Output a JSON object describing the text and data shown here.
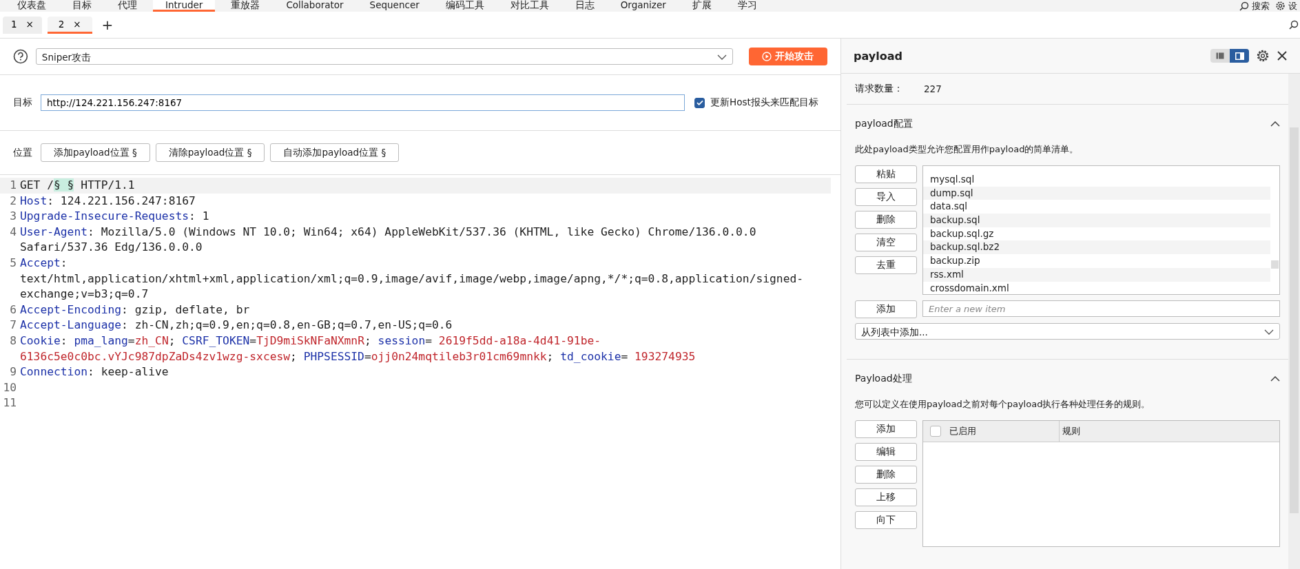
{
  "menu_tabs": [
    {
      "label": "仪表盘",
      "selected": false
    },
    {
      "label": "目标",
      "selected": false
    },
    {
      "label": "代理",
      "selected": false
    },
    {
      "label": "Intruder",
      "selected": true
    },
    {
      "label": "重放器",
      "selected": false
    },
    {
      "label": "Collaborator",
      "selected": false
    },
    {
      "label": "Sequencer",
      "selected": false
    },
    {
      "label": "编码工具",
      "selected": false
    },
    {
      "label": "对比工具",
      "selected": false
    },
    {
      "label": "日志",
      "selected": false
    },
    {
      "label": "Organizer",
      "selected": false
    },
    {
      "label": "扩展",
      "selected": false
    },
    {
      "label": "学习",
      "selected": false
    }
  ],
  "top_right": {
    "search_label": "搜索",
    "settings_label": "设"
  },
  "request_tabs": [
    {
      "label": "1",
      "close": "×",
      "selected": false
    },
    {
      "label": "2",
      "close": "×",
      "selected": true
    }
  ],
  "add_tab": "+",
  "attack": {
    "type": "Sniper攻击",
    "start_button": "开始攻击"
  },
  "target": {
    "label": "目标",
    "value": "http://124.221.156.247:8167",
    "update_host": {
      "label": "更新Host报头来匹配目标",
      "checked": true
    }
  },
  "positions": {
    "label": "位置",
    "buttons": [
      "添加payload位置 §",
      "清除payload位置 §",
      "自动添加payload位置 §"
    ]
  },
  "request_lines": [
    {
      "number": "1",
      "segments": [
        {
          "text": "GET /",
          "kind": "plain"
        },
        {
          "text": "§ §",
          "kind": "marker"
        },
        {
          "text": " HTTP/1.1",
          "kind": "plain"
        }
      ]
    },
    {
      "number": "2",
      "segments": [
        {
          "text": "Host",
          "kind": "name"
        },
        {
          "text": ": 124.221.156.247:8167",
          "kind": "plain"
        }
      ]
    },
    {
      "number": "3",
      "segments": [
        {
          "text": "Upgrade-Insecure-Requests",
          "kind": "name"
        },
        {
          "text": ": 1",
          "kind": "plain"
        }
      ]
    },
    {
      "number": "4",
      "segments": [
        {
          "text": "User-Agent",
          "kind": "name"
        },
        {
          "text": ": Mozilla/5.0 (Windows NT 10.0; Win64; x64) AppleWebKit/537.36 (KHTML, like Gecko) Chrome/136.0.0.0 Safari/537.36 Edg/136.0.0.0",
          "kind": "plain"
        }
      ]
    },
    {
      "number": "5",
      "segments": [
        {
          "text": "Accept",
          "kind": "name"
        },
        {
          "text": ": text/html,application/xhtml+xml,application/xml;q=0.9,image/avif,image/webp,image/apng,*/*;q=0.8,application/signed-exchange;v=b3;q=0.7",
          "kind": "plain"
        }
      ]
    },
    {
      "number": "6",
      "segments": [
        {
          "text": "Accept-Encoding",
          "kind": "name"
        },
        {
          "text": ": gzip, deflate, br",
          "kind": "plain"
        }
      ]
    },
    {
      "number": "7",
      "segments": [
        {
          "text": "Accept-Language",
          "kind": "name"
        },
        {
          "text": ": zh-CN,zh;q=0.9,en;q=0.8,en-GB;q=0.7,en-US;q=0.6",
          "kind": "plain"
        }
      ]
    },
    {
      "number": "8",
      "segments": [
        {
          "text": "Cookie",
          "kind": "name"
        },
        {
          "text": ": ",
          "kind": "plain"
        },
        {
          "text": "pma_lang",
          "kind": "name"
        },
        {
          "text": "=",
          "kind": "plain"
        },
        {
          "text": "zh_CN",
          "kind": "value"
        },
        {
          "text": "; ",
          "kind": "plain"
        },
        {
          "text": "CSRF_TOKEN",
          "kind": "name"
        },
        {
          "text": "=",
          "kind": "plain"
        },
        {
          "text": "TjD9miSkNFaNXmnR",
          "kind": "value"
        },
        {
          "text": "; ",
          "kind": "plain"
        },
        {
          "text": "session",
          "kind": "name"
        },
        {
          "text": "= ",
          "kind": "plain"
        },
        {
          "text": "2619f5dd-a18a-4d41-91be-6136c5e0c0bc.vYJc987dpZaDs4zv1wzg-sxcesw",
          "kind": "value"
        },
        {
          "text": "; ",
          "kind": "plain"
        },
        {
          "text": "PHPSESSID",
          "kind": "name"
        },
        {
          "text": "=",
          "kind": "plain"
        },
        {
          "text": "ojj0n24mqtileb3r01cm69mnkk",
          "kind": "value"
        },
        {
          "text": "; ",
          "kind": "plain"
        },
        {
          "text": "td_cookie",
          "kind": "name"
        },
        {
          "text": "= ",
          "kind": "plain"
        },
        {
          "text": "193274935",
          "kind": "value"
        }
      ]
    },
    {
      "number": "9",
      "segments": [
        {
          "text": "Connection",
          "kind": "name"
        },
        {
          "text": ": keep-alive",
          "kind": "plain"
        }
      ]
    },
    {
      "number": "10"
    },
    {
      "number": "11"
    }
  ],
  "payload_panel": {
    "title": "payload",
    "view_modes": [
      {
        "selected": false
      },
      {
        "selected": true
      }
    ],
    "request_count": {
      "label": "请求数量：",
      "value": "227"
    },
    "config": {
      "title": "payload配置",
      "expanded": true,
      "description": "此处payload类型允许您配置用作payload的简单清单。",
      "buttons": [
        "粘贴",
        "导入",
        "删除",
        "清空",
        "去重"
      ],
      "items": [
        "mysql.sql",
        "dump.sql",
        "data.sql",
        "backup.sql",
        "backup.sql.gz",
        "backup.sql.bz2",
        "backup.zip",
        "rss.xml",
        "crossdomain.xml"
      ],
      "add_button": "添加",
      "new_item_placeholder": "Enter a new item",
      "add_from_list": "从列表中添加..."
    },
    "processing": {
      "title": "Payload处理",
      "expanded": true,
      "description": "您可以定义在使用payload之前对每个payload执行各种处理任务的规则。",
      "buttons": [
        "添加",
        "编辑",
        "删除",
        "上移",
        "向下"
      ],
      "table": {
        "select_all_checked": false,
        "columns": [
          "已启用",
          "规则"
        ]
      }
    }
  }
}
